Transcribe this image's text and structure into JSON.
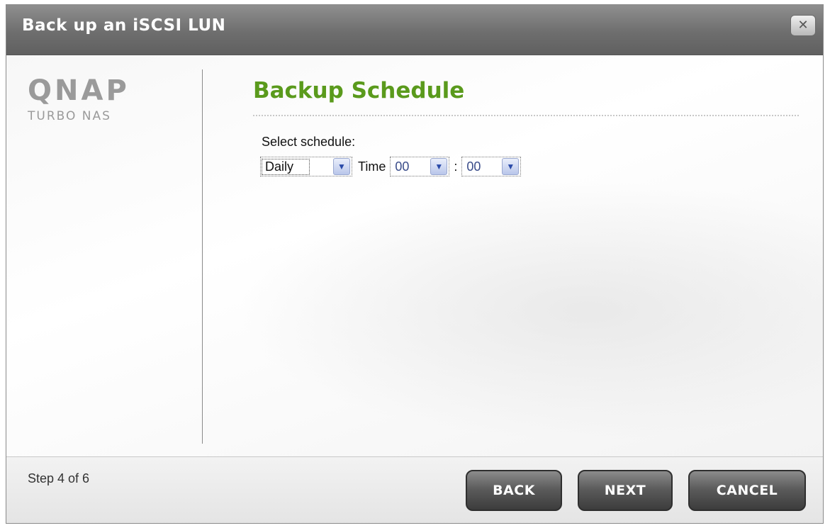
{
  "window": {
    "title": "Back up an iSCSI LUN",
    "close_icon": "close-icon"
  },
  "logo": {
    "main": "QNAP",
    "sub": "TURBO NAS"
  },
  "section": {
    "title": "Backup Schedule"
  },
  "schedule": {
    "label": "Select schedule:",
    "frequency": "Daily",
    "time_label": "Time",
    "hour": "00",
    "separator": ":",
    "minute": "00"
  },
  "footer": {
    "step": "Step 4 of 6",
    "back_label": "BACK",
    "next_label": "NEXT",
    "cancel_label": "CANCEL"
  },
  "colors": {
    "title_bar": "#6e6e6e",
    "section_title": "#5a9a1c",
    "button": "#4a4a4a"
  }
}
